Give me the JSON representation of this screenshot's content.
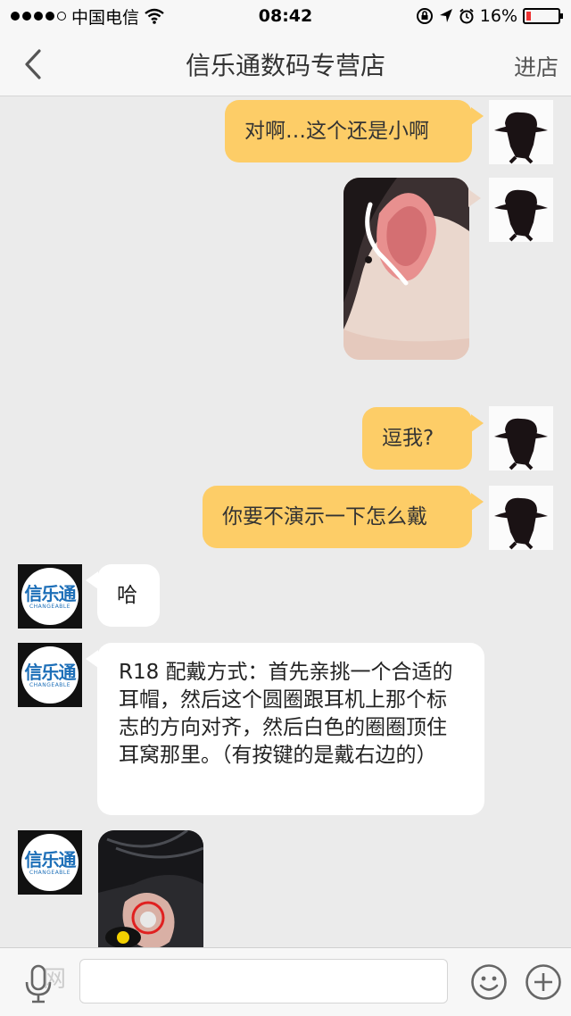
{
  "status_bar": {
    "carrier": "中国电信",
    "time": "08:42",
    "battery": "16%",
    "battery_level": 0.16,
    "signal_bars": 4,
    "icons": [
      "wifi-icon",
      "orientation-lock-icon",
      "location-arrow-icon",
      "alarm-icon",
      "battery-icon"
    ]
  },
  "nav": {
    "title": "信乐通数码专营店",
    "right_action": "进店",
    "back_icon": "chevron-left-icon"
  },
  "messages": [
    {
      "from": "me",
      "type": "text",
      "text": "对啊…这个还是小啊"
    },
    {
      "from": "me",
      "type": "image",
      "content": "ear-with-earphone-photo"
    },
    {
      "from": "me",
      "type": "text",
      "text": "逗我?"
    },
    {
      "from": "me",
      "type": "text",
      "text": "你要不演示一下怎么戴"
    },
    {
      "from": "shop",
      "type": "text",
      "text": "哈"
    },
    {
      "from": "shop",
      "type": "text",
      "text": "R18 配戴方式：首先亲挑一个合适的耳帽，然后这个圆圈跟耳机上那个标志的方向对齐，然后白色的圈圈顶住耳窝那里。（有按键的是戴右边的）"
    },
    {
      "from": "shop",
      "type": "image",
      "content": "earphone-wearing-photo"
    }
  ],
  "shop_avatar": {
    "name": "信乐通",
    "sub": "CHANGEABLE"
  },
  "input_bar": {
    "value": "",
    "icons": [
      "microphone-icon",
      "emoji-icon",
      "plus-icon"
    ]
  },
  "watermark": "网",
  "colors": {
    "outgoing_bubble": "#fdcd67",
    "incoming_bubble": "#ffffff",
    "background": "#ebebeb",
    "brand_blue": "#1d6fb8"
  }
}
